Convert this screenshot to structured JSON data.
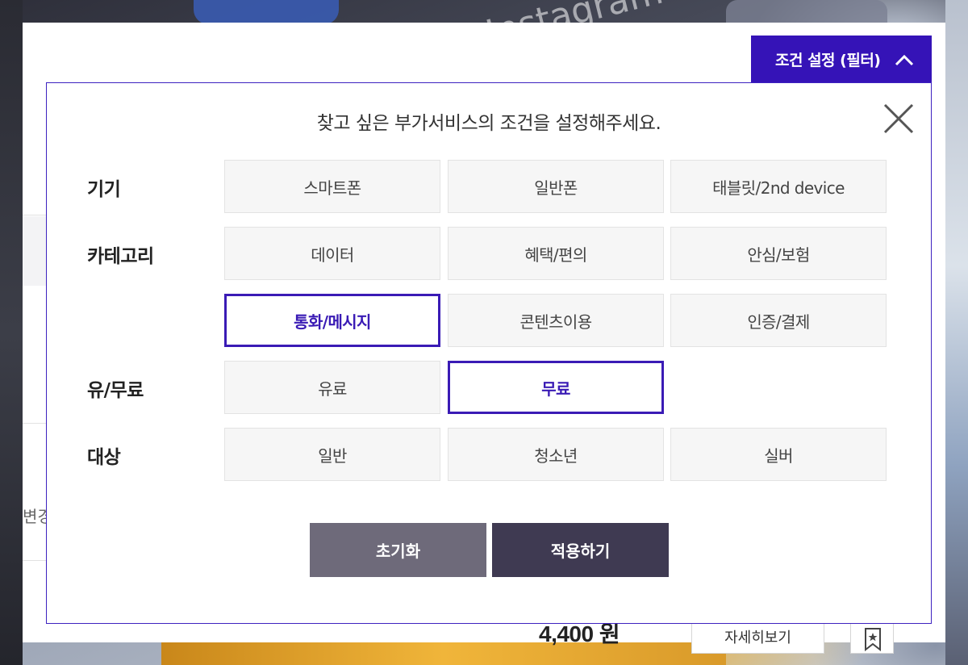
{
  "background": {
    "app_text": "Instagram"
  },
  "underlay": {
    "partial_text": "변경",
    "price": "4,400 원",
    "detail_button": "자세히보기",
    "bookmark_icon": "bookmark-star-icon"
  },
  "filter_toggle": {
    "label": "조건 설정 (필터)",
    "icon": "chevron-up-icon"
  },
  "modal": {
    "title": "찾고 싶은 부가서비스의 조건을 설정해주세요.",
    "close_icon": "close-icon",
    "groups": [
      {
        "label": "기기",
        "options": [
          {
            "label": "스마트폰",
            "selected": false
          },
          {
            "label": "일반폰",
            "selected": false
          },
          {
            "label": "태블릿/2nd device",
            "selected": false
          }
        ]
      },
      {
        "label": "카테고리",
        "options": [
          {
            "label": "데이터",
            "selected": false
          },
          {
            "label": "혜택/편의",
            "selected": false
          },
          {
            "label": "안심/보험",
            "selected": false
          },
          {
            "label": "통화/메시지",
            "selected": true
          },
          {
            "label": "콘텐츠이용",
            "selected": false
          },
          {
            "label": "인증/결제",
            "selected": false
          }
        ]
      },
      {
        "label": "유/무료",
        "options": [
          {
            "label": "유료",
            "selected": false
          },
          {
            "label": "무료",
            "selected": true
          }
        ]
      },
      {
        "label": "대상",
        "options": [
          {
            "label": "일반",
            "selected": false
          },
          {
            "label": "청소년",
            "selected": false
          },
          {
            "label": "실버",
            "selected": false
          }
        ]
      }
    ],
    "reset_button": "초기화",
    "apply_button": "적용하기"
  },
  "colors": {
    "accent": "#3513b7",
    "selected_border": "#3a1bb5",
    "reset_bg": "#6e6a7a",
    "apply_bg": "#3f3a52"
  }
}
